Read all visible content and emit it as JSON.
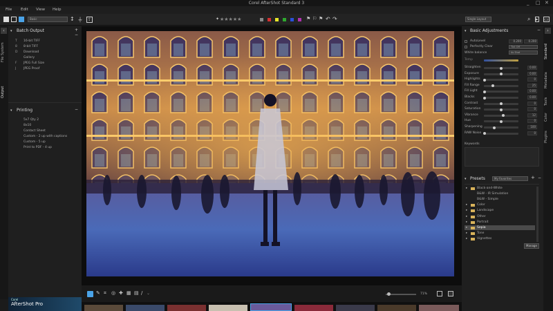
{
  "app": {
    "title": "Corel AfterShot Standard 3",
    "minimize": "_",
    "maximize": "□",
    "close": "✕"
  },
  "menu": {
    "file": "File",
    "edit": "Edit",
    "view": "View",
    "help": "Help"
  },
  "toolbar": {
    "dropdown_left": "Basic",
    "dropdown_right": "Single Layout",
    "rating_stars": "★★★★★",
    "color_labels": [
      "#d43030",
      "#e6e62a",
      "#2ea82e",
      "#2a50d8",
      "#b030b0"
    ],
    "accent": "#4aa3e8"
  },
  "left_panel": {
    "tabs": [
      "File System",
      "Output"
    ],
    "batch_output": {
      "title": "Batch Output",
      "items": [
        {
          "key": "T",
          "label": "16-bit TIFF"
        },
        {
          "key": "8",
          "label": "8-bit TIFF"
        },
        {
          "key": "D",
          "label": "Download"
        },
        {
          "key": "",
          "label": "Gallery"
        },
        {
          "key": "F",
          "label": "JPEG Full Size"
        },
        {
          "key": "J",
          "label": "JPEG Proof"
        }
      ]
    },
    "printing": {
      "title": "Printing",
      "items": [
        "5x7 Qty 2",
        "8x10",
        "Contact Sheet",
        "Custom - 2 up with captions",
        "Custom - 5 up",
        "Print to PDF - 4 up"
      ]
    },
    "promo": {
      "line1": "Corel",
      "line2": "AfterShot Pro"
    }
  },
  "bottom_bar": {
    "zoom": "71%"
  },
  "right_panel": {
    "tabs": [
      "Standard",
      "Metadata",
      "Tools",
      "Color",
      "Plugins"
    ],
    "basic_adjustments": {
      "title": "Basic Adjustments",
      "autolevel_label": "AutoLevel",
      "autolevel_values": [
        "0.200",
        "0.200"
      ],
      "perfectly_clear_label": "Perfectly Clear",
      "perfectly_clear_value": "Tint Off",
      "white_balance_label": "White balance",
      "white_balance_value": "As Shot",
      "temp_label": "Temp",
      "keywords_label": "Keywords",
      "sliders": [
        {
          "label": "Straighten",
          "value": "0.00",
          "level": 0.5
        },
        {
          "label": "Exposure",
          "value": "0.00",
          "level": 0.5
        },
        {
          "label": "Highlights",
          "value": "0",
          "level": 0.0
        },
        {
          "label": "Fill Range",
          "value": "25",
          "level": 0.25
        },
        {
          "label": "Fill Light",
          "value": "0.00",
          "level": 0.0
        },
        {
          "label": "Blacks",
          "value": "0.00",
          "level": 0.0
        },
        {
          "label": "Contrast",
          "value": "0",
          "level": 0.5
        },
        {
          "label": "Saturation",
          "value": "0",
          "level": 0.5
        },
        {
          "label": "Vibrance",
          "value": "12",
          "level": 0.56
        },
        {
          "label": "Hue",
          "value": "0",
          "level": 0.5
        },
        {
          "label": "Sharpening",
          "value": "100",
          "level": 0.3
        },
        {
          "label": "RAW Noise",
          "value": "0",
          "level": 0.0
        }
      ]
    },
    "presets": {
      "title": "Presets",
      "dropdown": "My Favorites",
      "items": [
        {
          "label": "Black-and-White",
          "type": "folder",
          "level": 0
        },
        {
          "label": "B&W - IR Simulation",
          "type": "item",
          "level": 1
        },
        {
          "label": "B&W - Simple",
          "type": "item",
          "level": 1
        },
        {
          "label": "Color",
          "type": "folder",
          "level": 0
        },
        {
          "label": "Landscape",
          "type": "folder",
          "level": 0
        },
        {
          "label": "Other",
          "type": "folder",
          "level": 0
        },
        {
          "label": "Portrait",
          "type": "folder",
          "level": 0
        },
        {
          "label": "Sepia",
          "type": "folder",
          "level": 0,
          "selected": true
        },
        {
          "label": "Tone",
          "type": "folder",
          "level": 0
        },
        {
          "label": "Vignettes",
          "type": "folder",
          "level": 0
        }
      ],
      "manage_button": "Manage"
    }
  }
}
